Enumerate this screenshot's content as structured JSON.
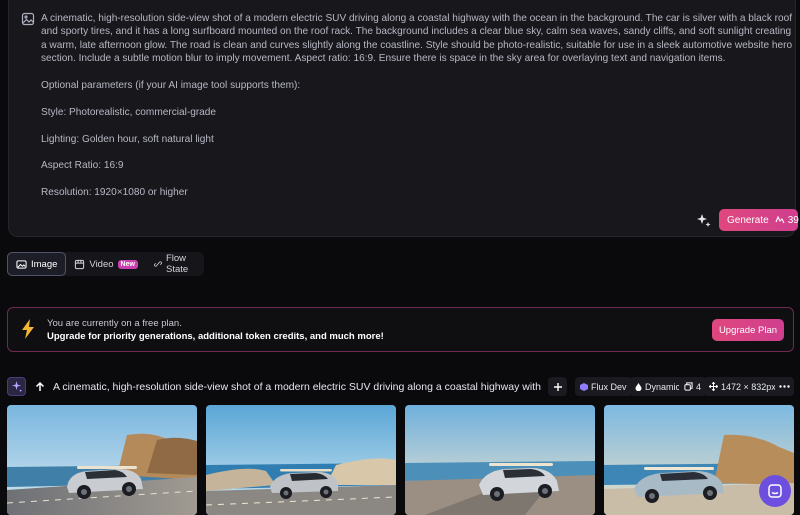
{
  "prompt": {
    "paragraph": "A cinematic, high-resolution side-view shot of a modern electric SUV driving along a coastal highway with the ocean in the background. The car is silver with a black roof and sporty tires, and it has a long surfboard mounted on the roof rack. The background includes a clear blue sky, calm sea waves, sandy cliffs, and soft sunlight creating a warm, late afternoon glow. The road is clean and curves slightly along the coastline. Style should be photo-realistic, suitable for use in a sleek automotive website hero section. Include a subtle motion blur to imply movement. Aspect ratio: 16:9. Ensure there is space in the sky area for overlaying text and navigation items.",
    "optional_header": "Optional parameters (if your AI image tool supports them):",
    "style": "Style: Photorealistic, commercial-grade",
    "lighting": "Lighting: Golden hour, soft natural light",
    "aspect": "Aspect Ratio: 16:9",
    "resolution": "Resolution: 1920×1080 or higher"
  },
  "generate": {
    "label": "Generate",
    "tokens": "39"
  },
  "tabs": [
    {
      "label": "Image"
    },
    {
      "label": "Video",
      "badge": "New"
    },
    {
      "label": "Flow State"
    }
  ],
  "banner": {
    "line1": "You are currently on a free plan.",
    "line2": "Upgrade for priority generations, additional token credits, and much more!",
    "button": "Upgrade Plan"
  },
  "generation": {
    "prompt_preview": "A cinematic, high-resolution side-view shot of a modern electric SUV driving along a coastal highway with the...",
    "model": "Flux Dev",
    "style": "Dynamic",
    "count": "4",
    "size": "1472 × 832px"
  },
  "colors": {
    "accent": "#e0477e",
    "bolt": "#f2b637",
    "chat": "#6d4fe0"
  }
}
